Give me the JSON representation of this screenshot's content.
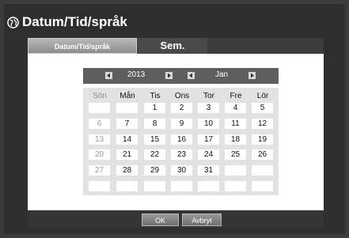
{
  "window": {
    "title": "Datum/Tid/språk"
  },
  "tabs": [
    {
      "label": "Datum/Tid/språk"
    },
    {
      "label": "Sem."
    }
  ],
  "calendar": {
    "year": "2013",
    "month": "Jan",
    "weekdays": [
      "Sön",
      "Mån",
      "Tis",
      "Ons",
      "Tor",
      "Fre",
      "Lör"
    ],
    "weeks": [
      [
        "",
        "",
        "1",
        "2",
        "3",
        "4",
        "5"
      ],
      [
        "6",
        "7",
        "8",
        "9",
        "10",
        "11",
        "12"
      ],
      [
        "13",
        "14",
        "15",
        "16",
        "17",
        "18",
        "19"
      ],
      [
        "20",
        "21",
        "22",
        "23",
        "24",
        "25",
        "26"
      ],
      [
        "27",
        "28",
        "29",
        "30",
        "31",
        "",
        ""
      ],
      [
        "",
        "",
        "",
        "",
        "",
        "",
        ""
      ]
    ]
  },
  "buttons": {
    "ok": "OK",
    "cancel": "Avbryt"
  },
  "colors": {
    "background": "#3b3b3b",
    "content": "#ffffff",
    "header": "#5e5e5e",
    "sunday_text": "#9a9a9a"
  },
  "icons": {
    "title": "globe-icon",
    "prev": "arrow-left-icon",
    "next": "arrow-right-icon"
  }
}
